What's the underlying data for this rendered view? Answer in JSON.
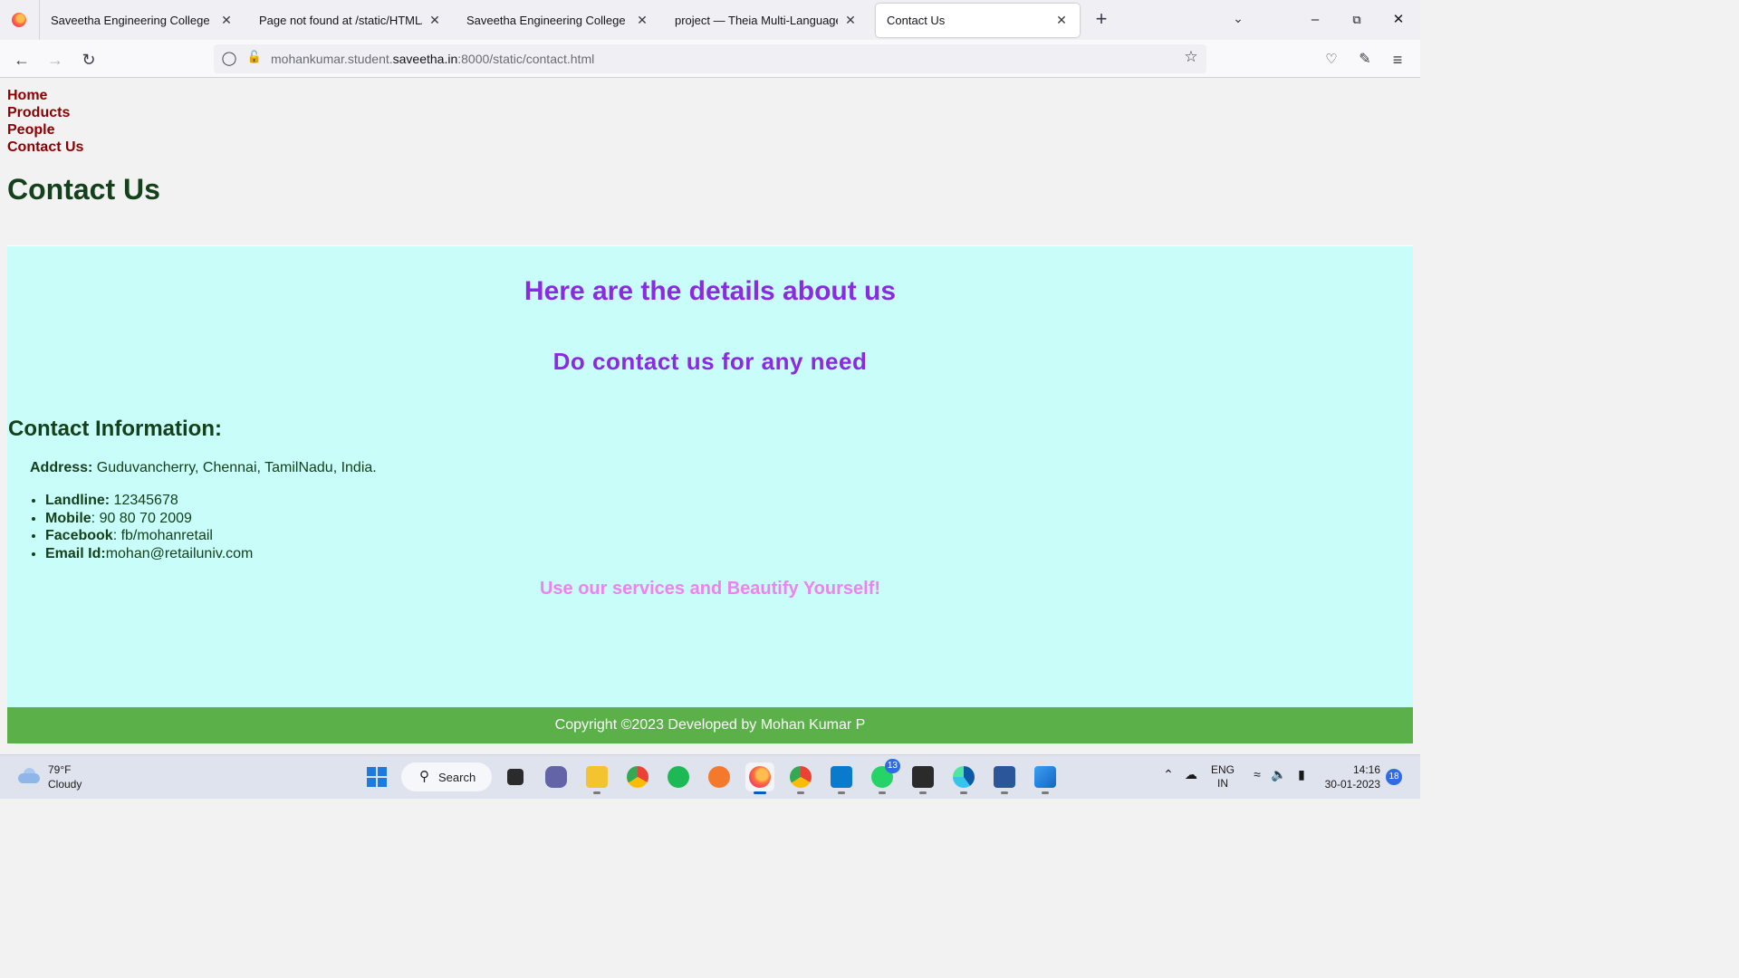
{
  "browser": {
    "tabs": [
      {
        "label": "Saveetha Engineering College"
      },
      {
        "label": "Page not found at /static/HTML/main.html"
      },
      {
        "label": "Saveetha Engineering College"
      },
      {
        "label": "project — Theia Multi-Language Explorer"
      },
      {
        "label": "Contact Us"
      }
    ],
    "url_prefix": "mohankumar.student.",
    "url_domain": "saveetha.in",
    "url_suffix": ":8000/static/contact.html"
  },
  "page": {
    "menu": [
      "Home",
      "Products",
      "People",
      "Contact Us"
    ],
    "title": "Contact Us",
    "heading1": "Here are the details about us",
    "heading2": "Do contact us for any need",
    "info_title": "Contact Information:",
    "address_label": "Address:",
    "address_value": " Guduvancherry, Chennai, TamilNadu, India.",
    "contacts": [
      {
        "label": "Landline:",
        "value": " 12345678"
      },
      {
        "label": "Mobile",
        "value": ": 90 80 70 2009"
      },
      {
        "label": "Facebook",
        "value": ": fb/mohanretail"
      },
      {
        "label": "Email Id:",
        "value": "mohan@retailuniv.com"
      }
    ],
    "tagline": "Use our services and Beautify Yourself!",
    "footer": "Copyright ©2023 Developed by Mohan Kumar P",
    "colors": {
      "menu_link": "#8b0000",
      "title": "#14401c",
      "heading": "#8a2be2",
      "content_bg": "#c9fdf9",
      "tagline": "#ee82ee",
      "footer_bg": "#5bb04a"
    }
  },
  "taskbar": {
    "temperature": "79°F",
    "condition": "Cloudy",
    "search_label": "Search",
    "vscode_badge": "13",
    "lang_line1": "ENG",
    "lang_line2": "IN",
    "time": "14:16",
    "date": "30-01-2023",
    "notifications": "18"
  }
}
